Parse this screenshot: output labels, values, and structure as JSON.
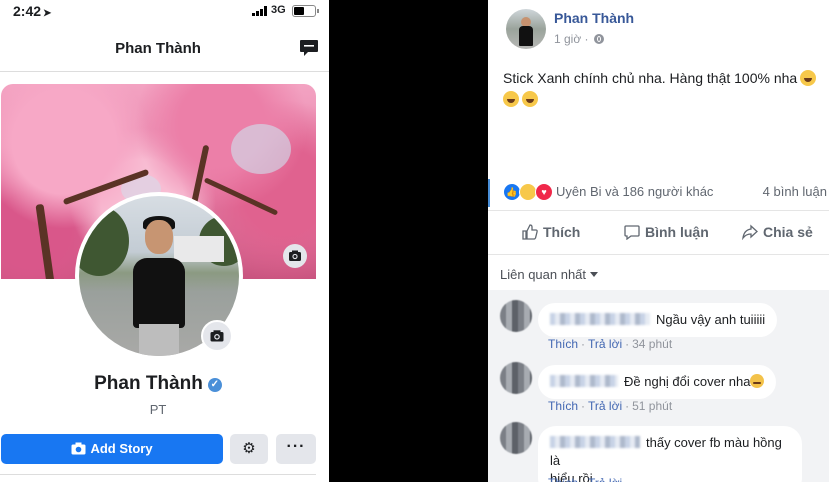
{
  "phone": {
    "status": {
      "time": "2:42",
      "network": "3G"
    },
    "nav_title": "Phan Thành",
    "profile": {
      "name": "Phan Thành",
      "nickname": "PT"
    },
    "buttons": {
      "add_story": "Add Story",
      "more": "···"
    }
  },
  "post": {
    "author": "Phan Thành",
    "time": "1 giờ",
    "text": "Stick Xanh chính chủ nha. Hàng thật 100% nha",
    "reactions": {
      "names": "Uyên Bi và 186 người khác",
      "comment_count": "4 bình luận"
    },
    "actions": {
      "like": "Thích",
      "comment": "Bình luận",
      "share": "Chia sẻ"
    },
    "sort_label": "Liên quan nhất",
    "comment_actions": {
      "like": "Thích",
      "reply": "Trả lời"
    },
    "comments": [
      {
        "text": "Ngầu vậy anh tuiiiii",
        "time": "34 phút"
      },
      {
        "text": "Đề nghị đổi cover nha",
        "time": "51 phút"
      },
      {
        "text_line1": "thấy cover fb màu hồng là",
        "text_line2": "hiểu rồi"
      }
    ]
  },
  "colors": {
    "facebook_blue": "#1877f2",
    "link_blue": "#385898",
    "verified": "#4a8fd8",
    "cherry_pink": "#e784ab"
  },
  "icons": [
    "location-arrow-icon",
    "signal-icon",
    "battery-icon",
    "messenger-icon",
    "camera-icon",
    "verified-icon",
    "gear-icon",
    "more-icon",
    "globe-icon",
    "emoji-icon",
    "like-reaction-icon",
    "haha-reaction-icon",
    "love-reaction-icon",
    "like-icon",
    "comment-icon",
    "share-icon",
    "caret-down-icon"
  ]
}
